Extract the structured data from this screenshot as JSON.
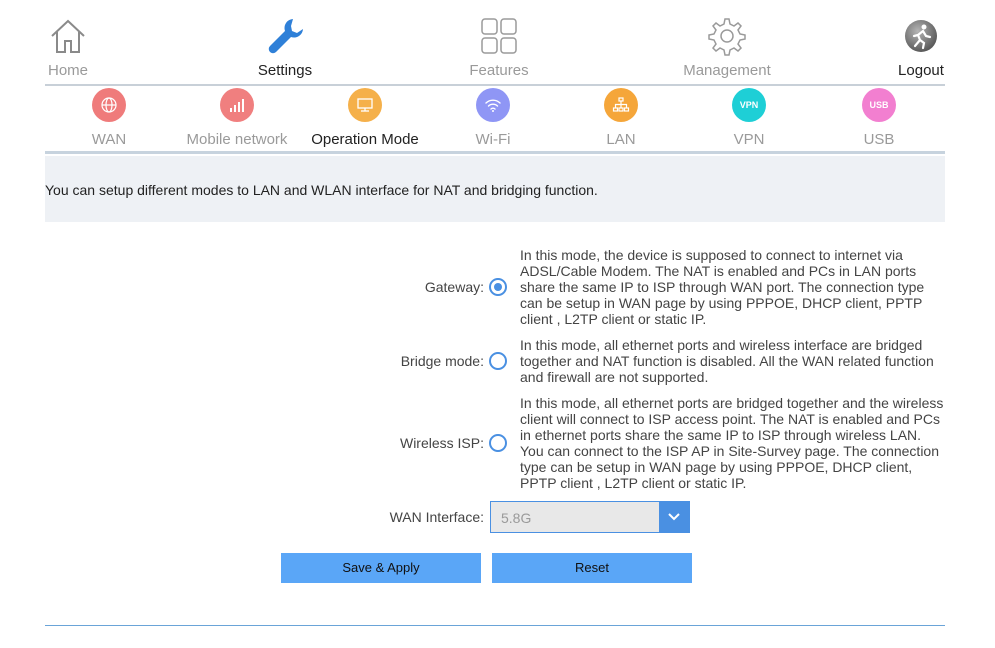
{
  "topnav": {
    "home": "Home",
    "settings": "Settings",
    "features": "Features",
    "management": "Management",
    "logout": "Logout"
  },
  "subnav": {
    "wan": "WAN",
    "mobile": "Mobile network",
    "operation": "Operation Mode",
    "wifi": "Wi-Fi",
    "lan": "LAN",
    "vpn": "VPN",
    "vpn_badge": "VPN",
    "usb": "USB",
    "usb_badge": "USB"
  },
  "banner": "You can setup different modes to LAN and WLAN interface for NAT and bridging function.",
  "options": {
    "gateway": {
      "label": "Gateway:",
      "desc": "In this mode, the device is supposed to connect to internet via ADSL/Cable Modem. The NAT is enabled and PCs in LAN ports share the same IP to ISP through WAN port. The connection type can be setup in WAN page by using PPPOE, DHCP client, PPTP client , L2TP client or static IP."
    },
    "bridge": {
      "label": "Bridge mode:",
      "desc": "In this mode, all ethernet ports and wireless interface are bridged together and NAT function is disabled. All the WAN related function and firewall are not supported."
    },
    "wisp": {
      "label": "Wireless ISP:",
      "desc": "In this mode, all ethernet ports are bridged together and the wireless client will connect to ISP access point. The NAT is enabled and PCs in ethernet ports share the same IP to ISP through wireless LAN. You can connect to the ISP AP in Site-Survey page. The connection type can be setup in WAN page by using PPPOE, DHCP client, PPTP client , L2TP client or static IP."
    },
    "selected": "gateway"
  },
  "wan_interface": {
    "label": "WAN Interface:",
    "value": "5.8G"
  },
  "buttons": {
    "save": "Save & Apply",
    "reset": "Reset"
  },
  "colors": {
    "accent": "#4a90e2",
    "button": "#5aa6f7",
    "wan": "#ef7b7b",
    "mobile": "#f07f7f",
    "operation": "#f5b04a",
    "wifi": "#8f96f5",
    "lan": "#f5a63a",
    "vpn": "#1ecfd6",
    "usb": "#f27fd0"
  }
}
